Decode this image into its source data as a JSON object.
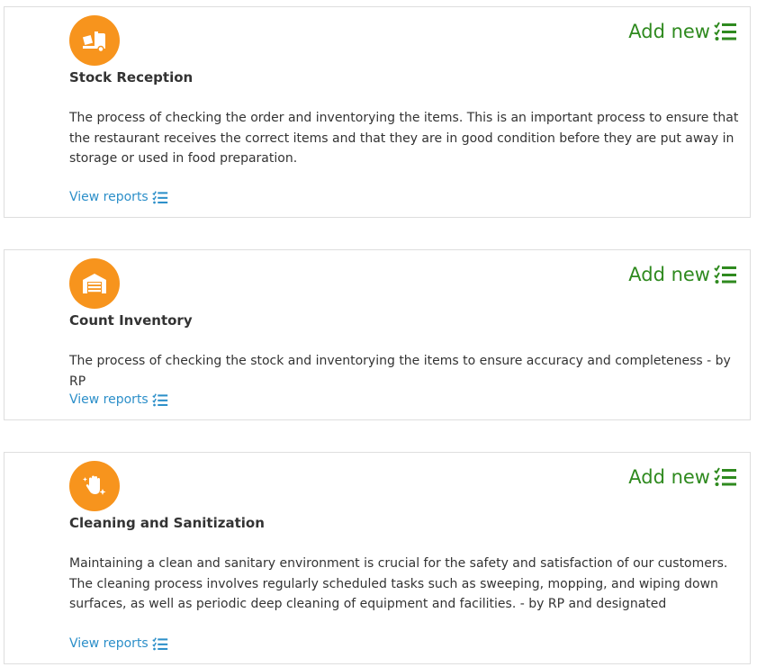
{
  "colors": {
    "icon_bg": "#f7941d",
    "add_new": "#2f8a1f",
    "link": "#2c8fc9",
    "text": "#333333"
  },
  "cards": [
    {
      "icon": "delivery-dolly-icon",
      "title": "Stock Reception",
      "description": "The process of checking the order and inventorying the items. This is an important process to ensure that the restaurant receives the correct items and that they are in good condition before they are put away in storage or used in food preparation.",
      "add_new_label": "Add new",
      "view_reports_label": "View reports"
    },
    {
      "icon": "warehouse-icon",
      "title": "Count Inventory",
      "description": "The process of checking the stock and inventorying the items to ensure accuracy and completeness - by RP",
      "add_new_label": "Add new",
      "view_reports_label": "View reports"
    },
    {
      "icon": "hand-sparkles-icon",
      "title": "Cleaning and Sanitization",
      "description": "Maintaining a clean and sanitary environment is crucial for the safety and satisfaction of our customers. The cleaning process involves regularly scheduled tasks such as sweeping, mopping, and wiping down surfaces, as well as periodic deep cleaning of equipment and facilities. - by RP and designated",
      "add_new_label": "Add new",
      "view_reports_label": "View reports"
    }
  ]
}
